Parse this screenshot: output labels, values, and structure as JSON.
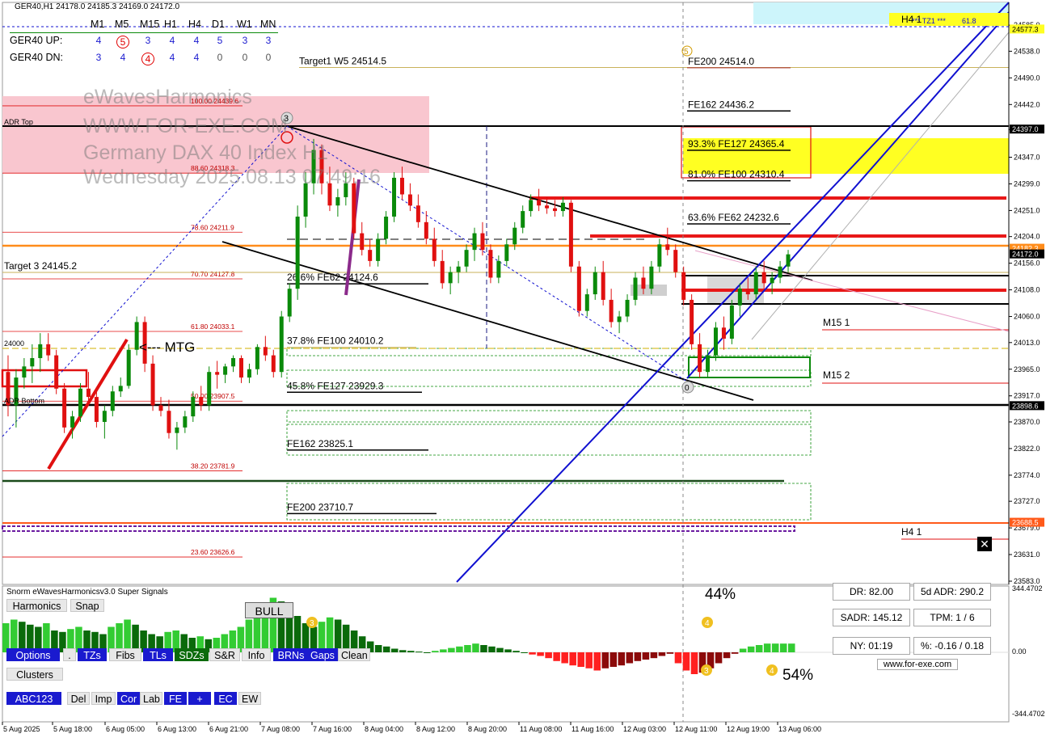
{
  "header": {
    "symbol_line": "GER40,H1  24178.0 24185.3 24169.0 24172.0"
  },
  "timeframes": [
    "M1",
    "M5",
    "M15",
    "H1",
    "H4",
    "D1",
    "W1",
    "MN"
  ],
  "up_row": {
    "label": "GER40 UP:",
    "values": [
      "4",
      "5",
      "3",
      "4",
      "4",
      "5",
      "3",
      "3"
    ],
    "circled_index": 1
  },
  "dn_row": {
    "label": "GER40 DN:",
    "values": [
      "3",
      "4",
      "4",
      "4",
      "4",
      "0",
      "0",
      "0"
    ],
    "circled_index": 2
  },
  "watermark": [
    "eWavesHarmonics",
    "WWW.FOR-EXE.COM",
    "Germany DAX 40 Index H1",
    "Wednesday 2025.08.13 07:49:16"
  ],
  "colors": {
    "bull": "#0a8a0a",
    "bear": "#e01010",
    "channel": "#1010d0",
    "zone_pink": "#f9c6cf",
    "zone_yellow": "#ffff22",
    "resistance": "#e81818",
    "orange": "#ff8c1a"
  },
  "chart_data": {
    "type": "candlestick",
    "symbol": "GER40",
    "timeframe": "H1",
    "ylim": [
      23583.0,
      24591.0
    ],
    "yticks": [
      "24585.0",
      "24538.0",
      "24490.0",
      "24442.0",
      "24397.0",
      "24347.0",
      "24299.0",
      "24251.0",
      "24204.0",
      "24156.0",
      "24108.0",
      "24060.0",
      "24013.0",
      "23965.0",
      "23917.0",
      "23870.0",
      "23822.0",
      "23774.0",
      "23727.0",
      "23679.0",
      "23631.0",
      "23583.0"
    ],
    "price_tags": [
      {
        "text": "24577.3",
        "price": 24577.3,
        "bg": "#ffff22",
        "fg": "#000"
      },
      {
        "text": "24397.0",
        "price": 24397.0,
        "bg": "#000",
        "fg": "#fff"
      },
      {
        "text": "24182.3",
        "price": 24182.3,
        "bg": "#ff8c1a",
        "fg": "#fff"
      },
      {
        "text": "24172.0",
        "price": 24172.0,
        "bg": "#000",
        "fg": "#fff"
      },
      {
        "text": "23898.6",
        "price": 23898.6,
        "bg": "#000",
        "fg": "#fff"
      },
      {
        "text": "23688.5",
        "price": 23688.5,
        "bg": "#ff5a1a",
        "fg": "#fff"
      }
    ],
    "xticks": [
      "5 Aug 2025",
      "5 Aug 18:00",
      "6 Aug 05:00",
      "6 Aug 13:00",
      "6 Aug 21:00",
      "7 Aug 08:00",
      "7 Aug 16:00",
      "8 Aug 04:00",
      "8 Aug 12:00",
      "8 Aug 20:00",
      "11 Aug 08:00",
      "11 Aug 16:00",
      "12 Aug 03:00",
      "12 Aug 11:00",
      "12 Aug 19:00",
      "13 Aug 06:00"
    ],
    "candles": [
      [
        23960,
        23990,
        23880,
        23900
      ],
      [
        23900,
        23965,
        23860,
        23950
      ],
      [
        23950,
        23985,
        23930,
        23970
      ],
      [
        23970,
        24010,
        23940,
        23985
      ],
      [
        23985,
        24030,
        23960,
        24010
      ],
      [
        24010,
        24030,
        23980,
        23990
      ],
      [
        23990,
        24000,
        23920,
        23930
      ],
      [
        23930,
        23940,
        23850,
        23860
      ],
      [
        23860,
        23890,
        23840,
        23880
      ],
      [
        23880,
        23940,
        23870,
        23930
      ],
      [
        23930,
        23960,
        23900,
        23915
      ],
      [
        23915,
        23930,
        23860,
        23870
      ],
      [
        23870,
        23900,
        23840,
        23890
      ],
      [
        23890,
        23935,
        23880,
        23925
      ],
      [
        23925,
        23950,
        23915,
        23935
      ],
      [
        23935,
        24010,
        23930,
        24000
      ],
      [
        24000,
        24060,
        23990,
        24050
      ],
      [
        24050,
        24060,
        23960,
        23975
      ],
      [
        23975,
        23990,
        23890,
        23900
      ],
      [
        23900,
        23915,
        23880,
        23890
      ],
      [
        23890,
        23910,
        23840,
        23850
      ],
      [
        23850,
        23870,
        23820,
        23860
      ],
      [
        23860,
        23890,
        23850,
        23880
      ],
      [
        23880,
        23925,
        23870,
        23915
      ],
      [
        23915,
        23935,
        23890,
        23900
      ],
      [
        23900,
        23970,
        23890,
        23960
      ],
      [
        23960,
        23980,
        23930,
        23955
      ],
      [
        23955,
        23975,
        23940,
        23970
      ],
      [
        23970,
        23990,
        23960,
        23985
      ],
      [
        23985,
        23990,
        23940,
        23950
      ],
      [
        23950,
        23975,
        23940,
        23965
      ],
      [
        23965,
        24010,
        23955,
        24005
      ],
      [
        24005,
        24025,
        23980,
        23990
      ],
      [
        23990,
        24000,
        23950,
        23960
      ],
      [
        23960,
        24070,
        23950,
        24060
      ],
      [
        24060,
        24120,
        24050,
        24110
      ],
      [
        24110,
        24260,
        24090,
        24240
      ],
      [
        24240,
        24320,
        24220,
        24300
      ],
      [
        24300,
        24380,
        24280,
        24360
      ],
      [
        24360,
        24370,
        24280,
        24300
      ],
      [
        24300,
        24330,
        24250,
        24260
      ],
      [
        24260,
        24290,
        24240,
        24275
      ],
      [
        24275,
        24320,
        24260,
        24300
      ],
      [
        24300,
        24310,
        24200,
        24210
      ],
      [
        24210,
        24230,
        24170,
        24180
      ],
      [
        24180,
        24200,
        24150,
        24160
      ],
      [
        24160,
        24210,
        24150,
        24200
      ],
      [
        24200,
        24250,
        24190,
        24240
      ],
      [
        24240,
        24320,
        24230,
        24310
      ],
      [
        24310,
        24330,
        24270,
        24280
      ],
      [
        24280,
        24300,
        24250,
        24260
      ],
      [
        24260,
        24280,
        24220,
        24230
      ],
      [
        24230,
        24250,
        24190,
        24200
      ],
      [
        24200,
        24220,
        24150,
        24160
      ],
      [
        24160,
        24180,
        24110,
        24120
      ],
      [
        24120,
        24150,
        24100,
        24140
      ],
      [
        24140,
        24160,
        24120,
        24150
      ],
      [
        24150,
        24190,
        24140,
        24180
      ],
      [
        24180,
        24220,
        24160,
        24210
      ],
      [
        24210,
        24230,
        24170,
        24180
      ],
      [
        24180,
        24190,
        24120,
        24130
      ],
      [
        24130,
        24170,
        24120,
        24160
      ],
      [
        24160,
        24200,
        24150,
        24190
      ],
      [
        24190,
        24230,
        24180,
        24220
      ],
      [
        24220,
        24260,
        24210,
        24250
      ],
      [
        24250,
        24280,
        24240,
        24270
      ],
      [
        24270,
        24290,
        24250,
        24260
      ],
      [
        24260,
        24275,
        24245,
        24255
      ],
      [
        24255,
        24270,
        24240,
        24250
      ],
      [
        24250,
        24275,
        24240,
        24265
      ],
      [
        24265,
        24270,
        24140,
        24150
      ],
      [
        24150,
        24160,
        24060,
        24070
      ],
      [
        24070,
        24110,
        24060,
        24100
      ],
      [
        24100,
        24150,
        24090,
        24140
      ],
      [
        24140,
        24160,
        24080,
        24090
      ],
      [
        24090,
        24110,
        24040,
        24050
      ],
      [
        24050,
        24070,
        24030,
        24060
      ],
      [
        24060,
        24100,
        24050,
        24090
      ],
      [
        24090,
        24140,
        24080,
        24130
      ],
      [
        24130,
        24150,
        24100,
        24110
      ],
      [
        24110,
        24160,
        24100,
        24150
      ],
      [
        24150,
        24200,
        24140,
        24190
      ],
      [
        24190,
        24220,
        24170,
        24180
      ],
      [
        24180,
        24190,
        24130,
        24140
      ],
      [
        24140,
        24150,
        24080,
        24090
      ],
      [
        24090,
        24100,
        24000,
        24010
      ],
      [
        24010,
        24030,
        23950,
        23960
      ],
      [
        23960,
        24000,
        23950,
        23990
      ],
      [
        23990,
        24050,
        23980,
        24040
      ],
      [
        24040,
        24060,
        24000,
        24020
      ],
      [
        24020,
        24090,
        24010,
        24080
      ],
      [
        24080,
        24120,
        24060,
        24110
      ],
      [
        24110,
        24130,
        24090,
        24100
      ],
      [
        24100,
        24150,
        24090,
        24140
      ],
      [
        24140,
        24160,
        24110,
        24120
      ],
      [
        24120,
        24140,
        24100,
        24130
      ],
      [
        24130,
        24160,
        24120,
        24150
      ],
      [
        24150,
        24180,
        24140,
        24172
      ]
    ],
    "levels": [
      {
        "label": "Target1 W5 24514.5",
        "price": 24514.5,
        "color": "#c9b25a"
      },
      {
        "label": "FE200 24514.0",
        "price": 24514.0,
        "color": "#a52a2a"
      },
      {
        "label": "FE162 24436.2",
        "price": 24436.2,
        "color": "#000"
      },
      {
        "label": "93.3% FE127 24365.4",
        "price": 24365.4,
        "color": "#000"
      },
      {
        "label": "81.0% FE100 24310.4",
        "price": 24310.4,
        "color": "#000"
      },
      {
        "label": "63.6% FE62 24232.6",
        "price": 24232.6,
        "color": "#000"
      },
      {
        "label": "Target 3 24145.2",
        "price": 24145.2,
        "color": "#c9b25a"
      },
      {
        "label": "26.6% FE62 24124.6",
        "price": 24124.6,
        "color": "#000"
      },
      {
        "label": "37.8% FE100 24010.2",
        "price": 24010.2,
        "color": "#c9b25a"
      },
      {
        "label": "45.8% FE127 23929.3",
        "price": 23929.3,
        "color": "#000"
      },
      {
        "label": "FE162 23825.1",
        "price": 23825.1,
        "color": "#000"
      },
      {
        "label": "FE200 23710.7",
        "price": 23710.7,
        "color": "#000"
      }
    ],
    "fib_levels": [
      {
        "label": "100.00 24439.6",
        "price": 24439.6
      },
      {
        "label": "88.60 24318.3",
        "price": 24318.3
      },
      {
        "label": "78.60 24211.9",
        "price": 24211.9
      },
      {
        "label": "70.70 24127.8",
        "price": 24127.8
      },
      {
        "label": "61.80 24033.1",
        "price": 24033.1
      },
      {
        "label": "50.00 23907.5",
        "price": 23907.5
      },
      {
        "label": "38.20 23781.9",
        "price": 23781.9
      },
      {
        "label": "23.60 23626.6",
        "price": 23626.6
      }
    ],
    "annotations": {
      "adr_top": "ADR Top",
      "adr_bottom": "ADR Bottom",
      "mtg": "<--- MTG",
      "m15_1": "M15 1",
      "m15_2": "M15 2",
      "h4_1_top": "H4 1",
      "h4_1_bottom": "H4 1",
      "tz1": "*** TZ1 ***",
      "tz1_val": "61.8",
      "level_24000": "24000",
      "wave3": "3",
      "wave5": "5",
      "wave_circle": "0"
    }
  },
  "indicator": {
    "title": "Snorm eWavesHarmonicsv3.0 Super Signals",
    "bull_label": "BULL",
    "pct_top": "44%",
    "pct_bottom": "54%",
    "signal_3a": "3",
    "signal_4a": "4",
    "signal_3b": "3",
    "signal_4b": "4",
    "yticks": [
      "344.4702",
      "0.00",
      "-344.4702"
    ],
    "histogram": [
      40,
      45,
      42,
      38,
      35,
      40,
      30,
      28,
      32,
      35,
      30,
      28,
      25,
      35,
      40,
      45,
      38,
      30,
      25,
      22,
      28,
      30,
      25,
      20,
      22,
      18,
      20,
      25,
      30,
      35,
      45,
      55,
      65,
      75,
      70,
      60,
      50,
      40,
      35,
      42,
      48,
      45,
      38,
      30,
      22,
      15,
      10,
      8,
      5,
      3,
      2,
      1,
      0,
      2,
      4,
      6,
      8,
      10,
      12,
      10,
      8,
      6,
      4,
      2,
      0,
      -3,
      -5,
      -8,
      -12,
      -15,
      -18,
      -20,
      -22,
      -25,
      -22,
      -20,
      -18,
      -15,
      -12,
      -10,
      -8,
      -5,
      -2,
      -15,
      -25,
      -30,
      -28,
      -22,
      -15,
      -8,
      -2,
      5,
      8,
      10,
      12,
      12,
      12,
      12
    ]
  },
  "buttons": {
    "row1": [
      "Harmonics",
      "Snap"
    ],
    "row2": [
      "Options",
      ".",
      "TZs",
      "Fibs",
      "TLs",
      "SDZs",
      "S&R",
      "Info",
      "BRNs",
      "Gaps",
      "Clean"
    ],
    "row3": [
      "Clusters"
    ],
    "row4": [
      "ABC123",
      "Del",
      "Imp",
      "Cor",
      "Lab",
      "FE",
      "+",
      "EC",
      "EW"
    ]
  },
  "stats": {
    "dr": "DR: 82.00",
    "adr5": "5d ADR: 290.2",
    "sadr": "SADR: 145.12",
    "tpm": "TPM: 1 / 6",
    "ny": "NY: 01:19",
    "pct": "%: -0.16 / 0.18",
    "site": "www.for-exe.com"
  }
}
